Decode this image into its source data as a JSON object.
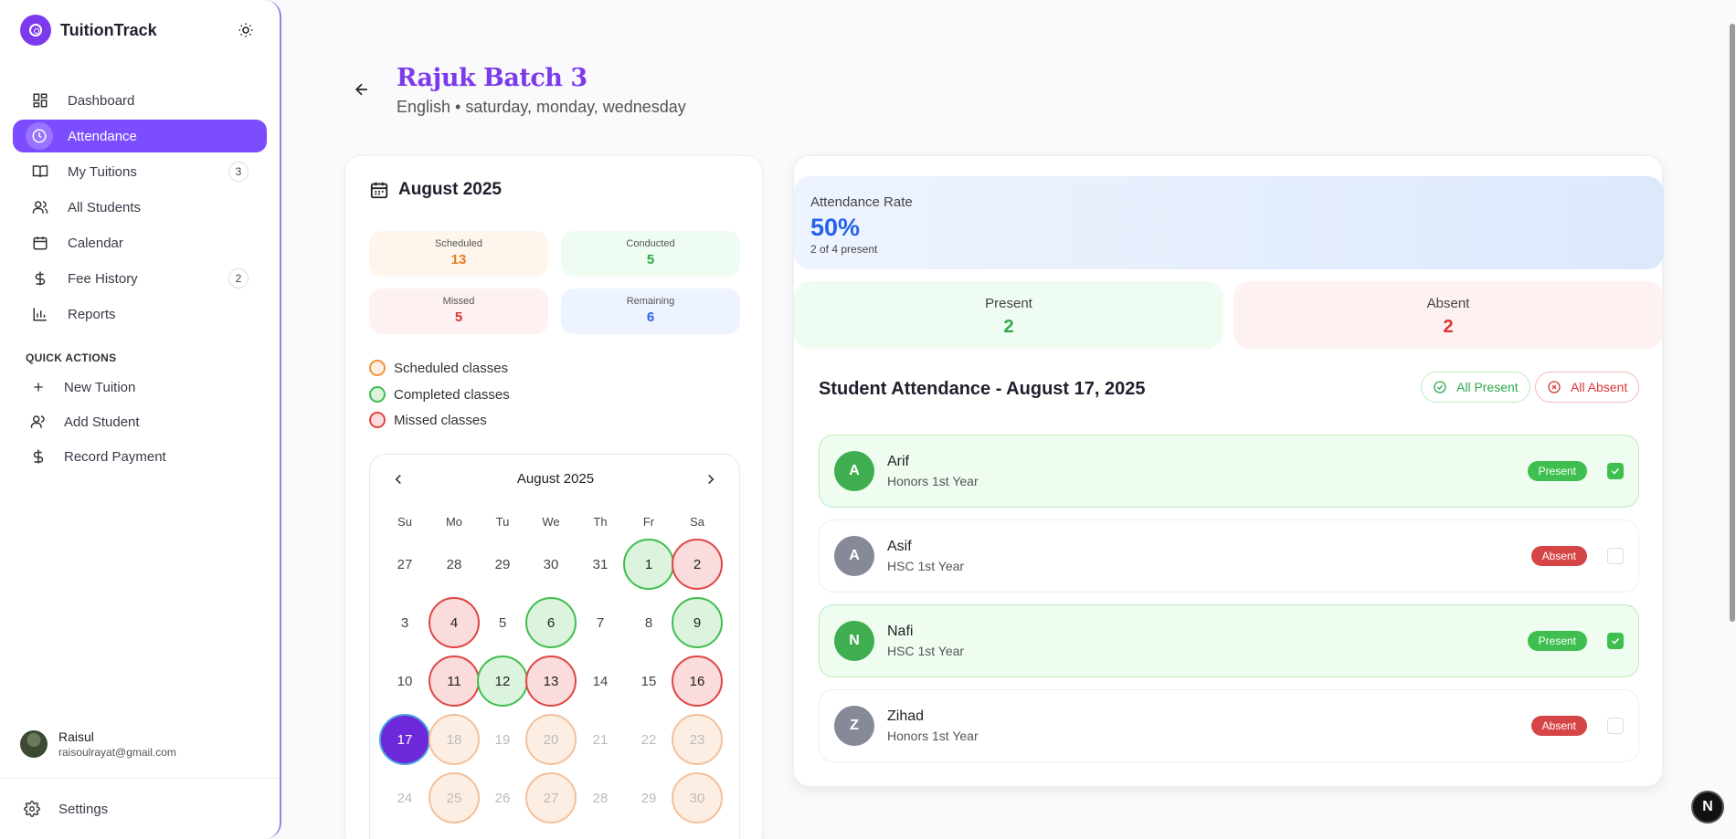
{
  "app": {
    "name": "TuitionTrack"
  },
  "sidebar": {
    "items": [
      {
        "label": "Dashboard",
        "icon": "dashboard-icon"
      },
      {
        "label": "Attendance",
        "icon": "clock-icon",
        "active": true
      },
      {
        "label": "My Tuitions",
        "icon": "book-icon",
        "count": "3"
      },
      {
        "label": "All Students",
        "icon": "users-icon"
      },
      {
        "label": "Calendar",
        "icon": "calendar-icon"
      },
      {
        "label": "Fee History",
        "icon": "dollar-icon",
        "count": "2"
      },
      {
        "label": "Reports",
        "icon": "bar-chart-icon"
      }
    ],
    "quick_actions_title": "QUICK ACTIONS",
    "quick_actions": [
      {
        "label": "New Tuition",
        "icon": "plus-icon"
      },
      {
        "label": "Add Student",
        "icon": "add-user-icon"
      },
      {
        "label": "Record Payment",
        "icon": "dollar-icon"
      }
    ],
    "user": {
      "name": "Raisul",
      "email": "raisoulrayat@gmail.com"
    },
    "settings_label": "Settings"
  },
  "header": {
    "title": "Rajuk Batch 3",
    "subtitle": "English • saturday, monday, wednesday"
  },
  "calendar_panel": {
    "month_title": "August 2025",
    "stats": [
      {
        "label": "Scheduled",
        "value": "13",
        "color": "#e67e22",
        "bg": "#fef6ec"
      },
      {
        "label": "Conducted",
        "value": "5",
        "color": "#2fa84a",
        "bg": "#effcf1"
      },
      {
        "label": "Missed",
        "value": "5",
        "color": "#d93636",
        "bg": "#fdf1f1"
      },
      {
        "label": "Remaining",
        "value": "6",
        "color": "#2563eb",
        "bg": "#eef4ff"
      }
    ],
    "legend": [
      {
        "label": "Scheduled classes",
        "color": "#f0953a",
        "bg": "#fdeee3"
      },
      {
        "label": "Completed classes",
        "color": "#3fbf4f",
        "bg": "#dcf3dd"
      },
      {
        "label": "Missed classes",
        "color": "#e24545",
        "bg": "#fadcdc"
      }
    ],
    "calendar": {
      "header": "August 2025",
      "weekdays": [
        "Su",
        "Mo",
        "Tu",
        "We",
        "Th",
        "Fr",
        "Sa"
      ],
      "weeks": [
        [
          {
            "d": "27",
            "s": "out"
          },
          {
            "d": "28",
            "s": "out"
          },
          {
            "d": "29",
            "s": "out"
          },
          {
            "d": "30",
            "s": "out"
          },
          {
            "d": "31",
            "s": "out"
          },
          {
            "d": "1",
            "s": "comp"
          },
          {
            "d": "2",
            "s": "miss"
          }
        ],
        [
          {
            "d": "3",
            "s": "out"
          },
          {
            "d": "4",
            "s": "miss"
          },
          {
            "d": "5",
            "s": "out"
          },
          {
            "d": "6",
            "s": "comp"
          },
          {
            "d": "7",
            "s": "out"
          },
          {
            "d": "8",
            "s": "out"
          },
          {
            "d": "9",
            "s": "comp"
          }
        ],
        [
          {
            "d": "10",
            "s": "out"
          },
          {
            "d": "11",
            "s": "miss"
          },
          {
            "d": "12",
            "s": "comp"
          },
          {
            "d": "13",
            "s": "miss"
          },
          {
            "d": "14",
            "s": "out"
          },
          {
            "d": "15",
            "s": "out"
          },
          {
            "d": "16",
            "s": "miss"
          }
        ],
        [
          {
            "d": "17",
            "s": "today"
          },
          {
            "d": "18",
            "s": "sched"
          },
          {
            "d": "19",
            "s": "fut"
          },
          {
            "d": "20",
            "s": "sched"
          },
          {
            "d": "21",
            "s": "fut"
          },
          {
            "d": "22",
            "s": "fut"
          },
          {
            "d": "23",
            "s": "sched"
          }
        ],
        [
          {
            "d": "24",
            "s": "fut"
          },
          {
            "d": "25",
            "s": "sched"
          },
          {
            "d": "26",
            "s": "fut"
          },
          {
            "d": "27",
            "s": "sched"
          },
          {
            "d": "28",
            "s": "fut"
          },
          {
            "d": "29",
            "s": "fut"
          },
          {
            "d": "30",
            "s": "sched"
          }
        ]
      ]
    }
  },
  "attendance": {
    "rate_label": "Attendance Rate",
    "rate_value": "50%",
    "rate_sub": "2 of 4 present",
    "present_label": "Present",
    "present_value": "2",
    "absent_label": "Absent",
    "absent_value": "2",
    "section_title": "Student Attendance - August 17, 2025",
    "all_present_label": "All Present",
    "all_absent_label": "All Absent",
    "students": [
      {
        "initial": "A",
        "name": "Arif",
        "class": "Honors 1st Year",
        "status": "Present",
        "checked": true
      },
      {
        "initial": "A",
        "name": "Asif",
        "class": "HSC 1st Year",
        "status": "Absent",
        "checked": false
      },
      {
        "initial": "N",
        "name": "Nafi",
        "class": "HSC 1st Year",
        "status": "Present",
        "checked": true
      },
      {
        "initial": "Z",
        "name": "Zihad",
        "class": "Honors 1st Year",
        "status": "Absent",
        "checked": false
      }
    ]
  },
  "floating_button": {
    "label": "N"
  }
}
